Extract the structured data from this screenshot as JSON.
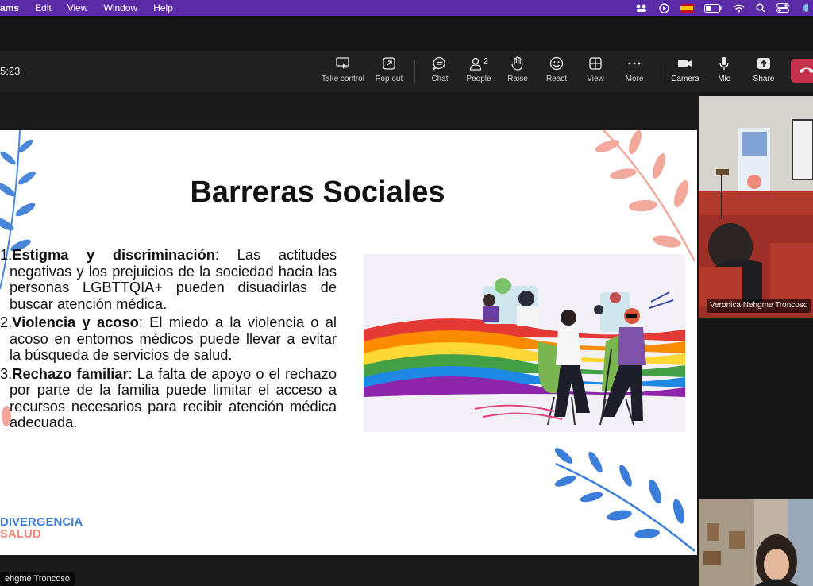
{
  "menubar": {
    "app_name": "ams",
    "items": [
      "Edit",
      "View",
      "Window",
      "Help"
    ]
  },
  "toolbar": {
    "timer": "5:23",
    "buttons": [
      {
        "label": "Take control",
        "icon": "take-control-icon"
      },
      {
        "label": "Pop out",
        "icon": "pop-out-icon"
      },
      {
        "label": "Chat",
        "icon": "chat-icon"
      },
      {
        "label": "People",
        "icon": "people-icon",
        "count": "2"
      },
      {
        "label": "Raise",
        "icon": "raise-hand-icon"
      },
      {
        "label": "React",
        "icon": "react-icon"
      },
      {
        "label": "View",
        "icon": "view-grid-icon"
      },
      {
        "label": "More",
        "icon": "more-icon"
      },
      {
        "label": "Camera",
        "icon": "camera-icon"
      },
      {
        "label": "Mic",
        "icon": "mic-icon"
      },
      {
        "label": "Share",
        "icon": "share-icon"
      }
    ],
    "end_call_color": "#c4314b"
  },
  "slide": {
    "title": "Barreras Sociales",
    "points": [
      {
        "num": "1.",
        "heading": "Estigma y discriminación",
        "text": ": Las actitudes negativas y los prejuicios de la sociedad hacia las personas LGBTTQIA+ pueden disuadirlas de buscar atención médica."
      },
      {
        "num": "2.",
        "heading": "Violencia y acoso",
        "text": ": El miedo a la violencia o al acoso en entornos médicos puede llevar a evitar la búsqueda de servicios de salud."
      },
      {
        "num": "3.",
        "heading": "Rechazo familiar",
        "text": ": La falta de apoyo o el rechazo por parte de la familia puede limitar el acceso a recursos necesarios para recibir atención médica adecuada."
      }
    ],
    "brand_line1": "DIVERGENCIA",
    "brand_line2": "SALUD",
    "colors": {
      "brand_blue": "#3b7dd8",
      "brand_coral": "#f08a7a",
      "leaf_blue": "#4a86d8",
      "leaf_pink": "#f2a99c"
    }
  },
  "presenter_name": "ehgme Troncoso",
  "participants": [
    {
      "name": "Veronica Nehgme Troncoso"
    }
  ]
}
